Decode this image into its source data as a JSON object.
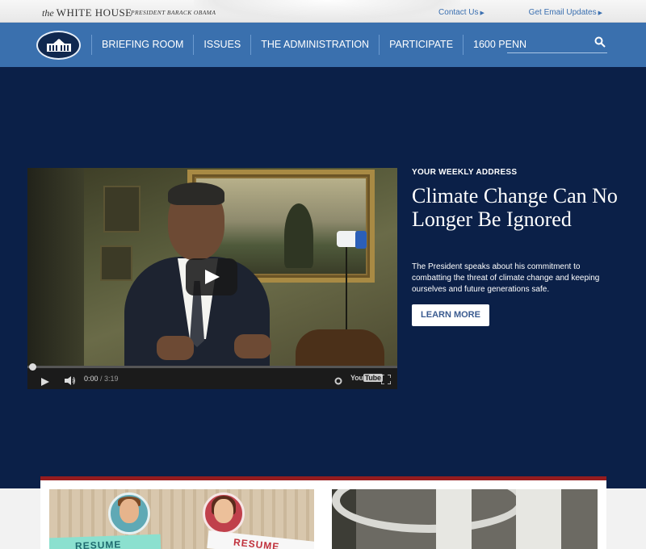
{
  "topbar": {
    "site_title_prefix": "the",
    "site_title_main": "WHITE HOUSE",
    "site_subtitle": "PRESIDENT BARACK OBAMA",
    "links": [
      "Contact Us",
      "Get Email Updates"
    ]
  },
  "nav": {
    "items": [
      "BRIEFING ROOM",
      "ISSUES",
      "THE ADMINISTRATION",
      "PARTICIPATE",
      "1600 PENN"
    ],
    "search_placeholder": ""
  },
  "hero": {
    "kicker": "YOUR WEEKLY ADDRESS",
    "title": "Climate Change Can No Longer Be Ignored",
    "description": "The President speaks about his commitment to combatting the threat of climate change and keeping ourselves and future generations safe.",
    "cta": "LEARN MORE",
    "video": {
      "current_time": "0:00",
      "separator": " / ",
      "duration": "3:19",
      "progress": 0,
      "brand_left": "You",
      "brand_right": "Tube"
    }
  },
  "cards": [
    {
      "resume_labels": [
        "RESUME",
        "RESUME"
      ]
    },
    {}
  ],
  "colors": {
    "nav_blue": "#3a70ae",
    "hero_navy": "#0b2048",
    "accent_red": "#951c1f",
    "link_blue": "#3a6fb0"
  }
}
